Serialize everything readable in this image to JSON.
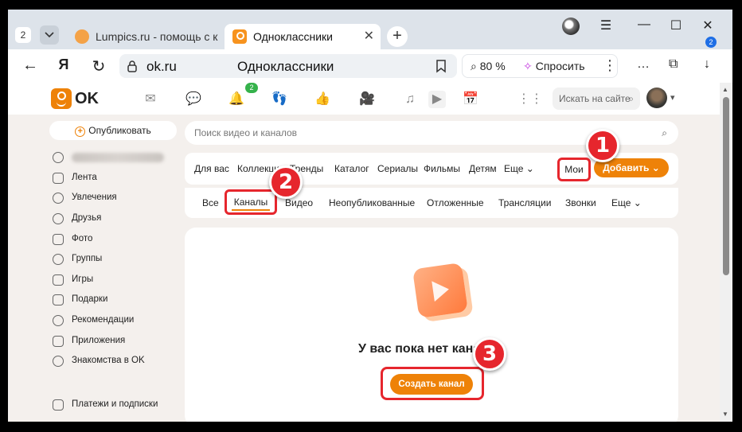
{
  "browser": {
    "tab_count": "2",
    "tabs": [
      {
        "title": "Lumpics.ru - помощь с ком"
      },
      {
        "title": "Одноклассники"
      }
    ],
    "url": "ok.ru",
    "page_title": "Одноклассники",
    "zoom": "80 %",
    "ask_label": "Спросить",
    "downloads_badge": "2"
  },
  "site": {
    "logo_text": "OK",
    "notifications_badge": "2",
    "search_placeholder": "Искать на сайте"
  },
  "sidebar": {
    "publish_label": "Опубликовать",
    "items": [
      {
        "label": "Лента",
        "icon": "home-icon"
      },
      {
        "label": "Увлечения",
        "icon": "interests-icon"
      },
      {
        "label": "Друзья",
        "icon": "friends-icon"
      },
      {
        "label": "Фото",
        "icon": "photo-icon"
      },
      {
        "label": "Группы",
        "icon": "groups-icon"
      },
      {
        "label": "Игры",
        "icon": "gamepad-icon"
      },
      {
        "label": "Подарки",
        "icon": "gift-icon"
      },
      {
        "label": "Рекомендации",
        "icon": "recommendations-icon"
      },
      {
        "label": "Приложения",
        "icon": "apps-icon"
      },
      {
        "label": "Знакомства в OK",
        "icon": "dating-icon"
      },
      {
        "label": "Платежи и подписки",
        "icon": "payments-icon"
      }
    ]
  },
  "video": {
    "search_placeholder": "Поиск видео и каналов",
    "categories": [
      "Для вас",
      "Коллекции",
      "Тренды",
      "Каталог",
      "Сериалы",
      "Фильмы",
      "Детям",
      "Еще"
    ],
    "my_label": "Мои",
    "add_label": "Добавить",
    "subtabs": [
      "Все",
      "Каналы",
      "Видео",
      "Неопубликованные",
      "Отложенные",
      "Трансляции",
      "Звонки",
      "Еще"
    ],
    "empty_text": "У вас пока нет каналов",
    "create_label": "Создать канал"
  },
  "annotations": [
    "1",
    "2",
    "3"
  ],
  "colors": {
    "accent": "#ee8208",
    "highlight": "#e6262d",
    "badge_green": "#35b24b"
  }
}
